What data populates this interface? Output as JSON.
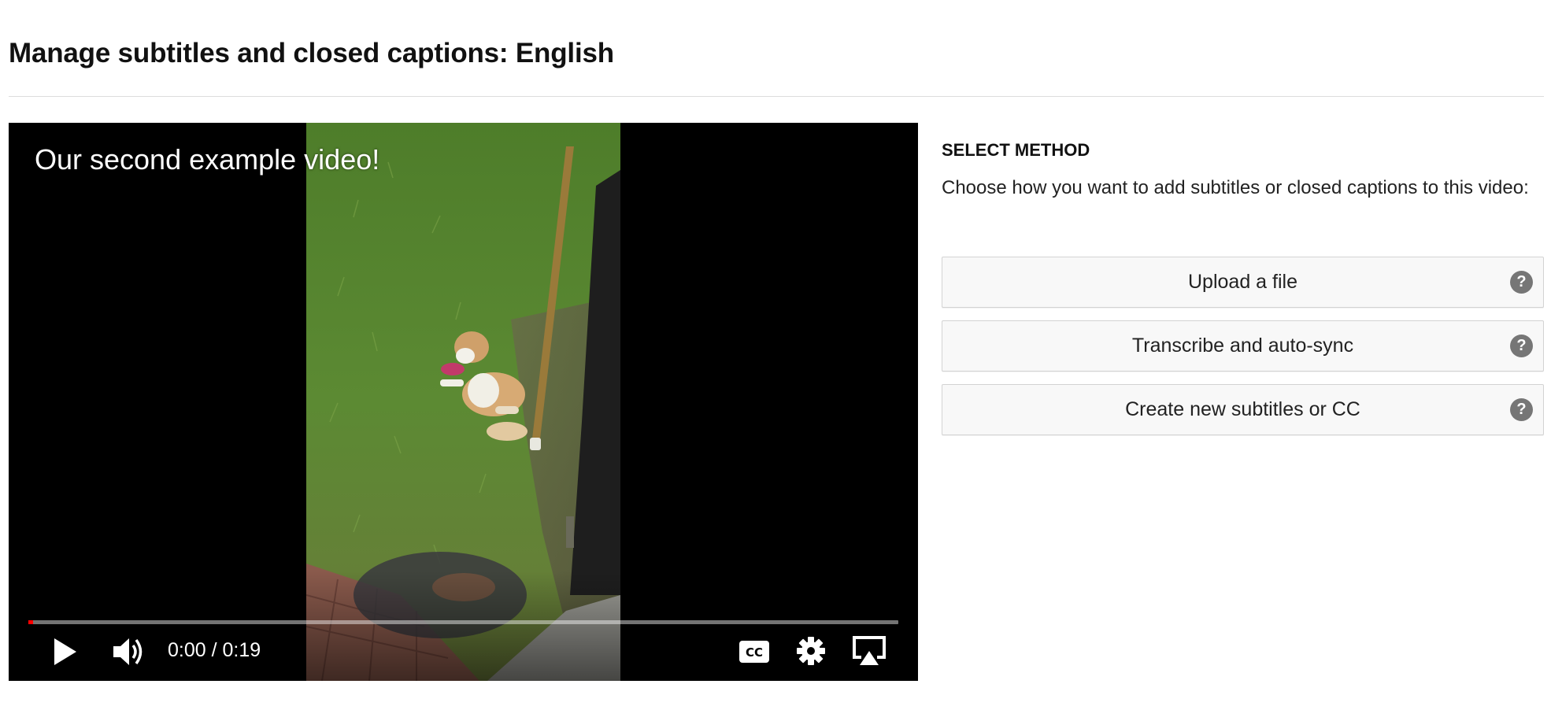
{
  "page": {
    "title": "Manage subtitles and closed captions: English"
  },
  "player": {
    "caption_text": "Our second example video!",
    "time_display": "0:00 / 0:19",
    "progress": 0.005,
    "colors": {
      "progress_played": "#ff0000",
      "background": "#000000"
    },
    "controls": {
      "play_icon": "play-icon",
      "volume_icon": "volume-icon",
      "cc_icon": "closed-captions-icon",
      "settings_icon": "gear-icon",
      "airplay_icon": "airplay-icon"
    }
  },
  "method_panel": {
    "heading": "SELECT METHOD",
    "description": "Choose how you want to add subtitles or closed captions to this video:",
    "buttons": [
      {
        "label": "Upload a file",
        "help": "?"
      },
      {
        "label": "Transcribe and auto-sync",
        "help": "?"
      },
      {
        "label": "Create new subtitles or CC",
        "help": "?"
      }
    ]
  }
}
